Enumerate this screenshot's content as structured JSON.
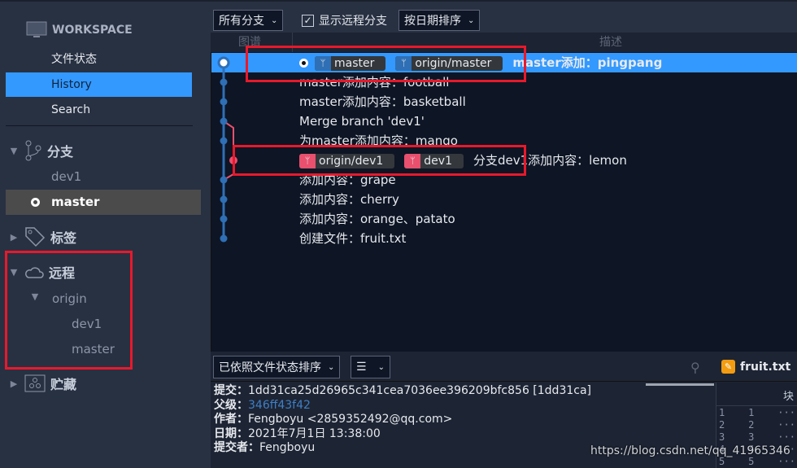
{
  "sidebar": {
    "workspace": "WORKSPACE",
    "nav": [
      "文件状态",
      "History",
      "Search"
    ],
    "branches": {
      "title": "分支",
      "items": [
        "dev1",
        "master"
      ]
    },
    "tags": {
      "title": "标签"
    },
    "remotes": {
      "title": "远程",
      "origin": "origin",
      "items": [
        "dev1",
        "master"
      ]
    },
    "stash": {
      "title": "贮藏"
    }
  },
  "toolbar": {
    "branch_filter": "所有分支",
    "show_remote": "显示远程分支",
    "show_remote_checked": true,
    "sort": "按日期排序"
  },
  "columns": {
    "graph": "图谱",
    "desc": "描述"
  },
  "commits": [
    {
      "tags": [
        "master",
        "origin/master"
      ],
      "msg": "master添加：pingpang",
      "selected": true
    },
    {
      "msg": "master添加内容：football"
    },
    {
      "msg": "master添加内容：basketball"
    },
    {
      "msg": "Merge branch 'dev1'"
    },
    {
      "msg": "为master添加内容：mango"
    },
    {
      "tags": [
        "origin/dev1",
        "dev1"
      ],
      "msg": "分支dev1添加内容：lemon"
    },
    {
      "msg": "添加内容：grape"
    },
    {
      "msg": "添加内容：cherry"
    },
    {
      "msg": "添加内容：orange、patato"
    },
    {
      "msg": "创建文件：fruit.txt"
    }
  ],
  "bottom": {
    "sort": "已依照文件状态排序",
    "view_icon": "list-icon",
    "file": "fruit.txt"
  },
  "details": {
    "commit_label": "提交：",
    "commit": "1dd31ca25d26965c341cea7036ee396209bfc856 [1dd31ca]",
    "parent_label": "父级：",
    "parent": "346ff43f42",
    "author_label": "作者：",
    "author": "Fengboyu <2859352492@qq.com>",
    "date_label": "日期：",
    "date": "2021年7月1日 13:38:00",
    "committer_label": "提交者：",
    "committer": "Fengboyu"
  },
  "diff": {
    "header": "块",
    "lines": [
      "1",
      "2",
      "3",
      "4",
      "5"
    ]
  },
  "watermark": "https://blog.csdn.net/qq_41965346",
  "colors": {
    "accent": "#3399ff",
    "master_lane": "#2f6fb5",
    "dev_lane": "#e8506e",
    "annotation": "#e8192c"
  }
}
